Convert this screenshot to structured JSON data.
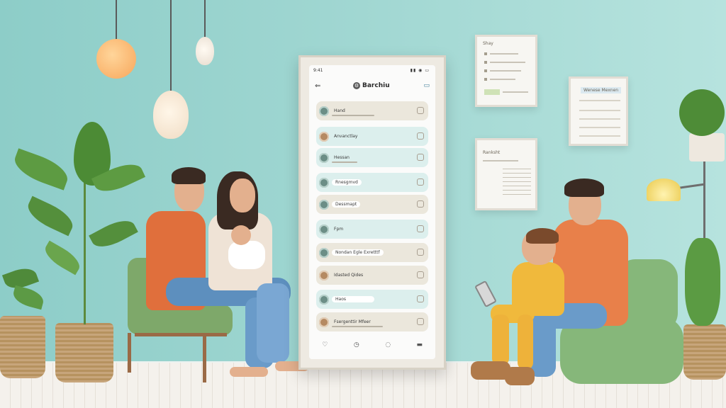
{
  "phone_app": {
    "status_time": "9:41",
    "status_icons": "▮▮ ◉ ▭",
    "title": "Barchiu",
    "logo_glyph": "⚙",
    "back_icon": "back-arrow-icon",
    "folder_icon": "folder-icon",
    "list_items": [
      {
        "label": "Hand",
        "style": "beige"
      },
      {
        "label": "Anvanctlay",
        "style": "mint"
      },
      {
        "label": "Hessan",
        "style": "mint"
      },
      {
        "label": "Rnesgmvd",
        "style": "mint"
      },
      {
        "label": "Dessmapt",
        "style": "beige"
      },
      {
        "label": "Fpm",
        "style": "mint"
      },
      {
        "label": "Nondan Egle Exretttf",
        "style": "beige"
      },
      {
        "label": "Idasted Qides",
        "style": "beige"
      },
      {
        "label": "Haos",
        "style": "mint"
      },
      {
        "label": "Fsergenttir Mfeer",
        "style": "beige"
      }
    ],
    "tab_icons": [
      "heart-icon",
      "clock-icon",
      "chat-icon",
      "card-icon"
    ]
  },
  "wall_frames": [
    {
      "title": "Shay"
    },
    {
      "title": "Wenese Mexnen"
    },
    {
      "title": "Ranksht"
    }
  ],
  "colors": {
    "wall": "#9fd6d1",
    "accent_mint": "#dcefed",
    "accent_beige": "#ebe7dc",
    "sofa_green": "#86b77a"
  }
}
